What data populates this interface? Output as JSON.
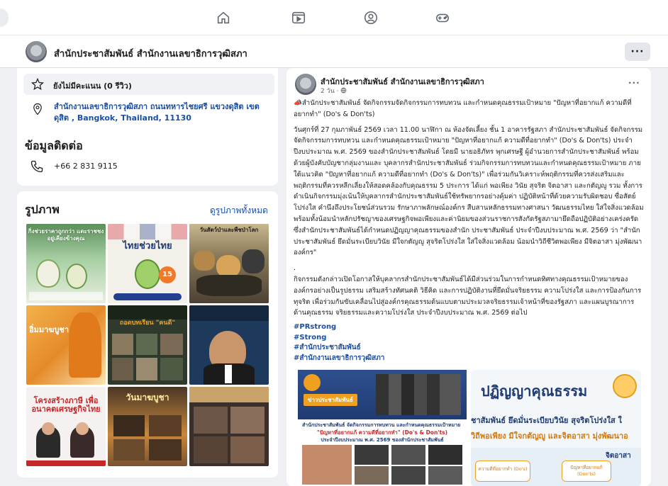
{
  "nav": {
    "icons": [
      "home-icon",
      "video-icon",
      "groups-icon",
      "gaming-icon"
    ]
  },
  "page": {
    "name": "สำนักประชาสัมพันธ์ สำนักงานเลขาธิการวุฒิสภา",
    "more_label": "···"
  },
  "about": {
    "rating": "ยังไม่มีคะแนน (0 รีวิว)",
    "address": "สำนักงานเลขาธิการวุฒิสภา ถนนทหารไชยศรี แขวงดุสิต เขตดุสิต , Bangkok, Thailand, 11130",
    "contact_heading": "ข้อมูลติดต่อ",
    "phone": "+66 2 831 9115"
  },
  "photos": {
    "title": "รูปภาพ",
    "see_all": "ดูรูปภาพทั้งหมด",
    "tiles": [
      {
        "caption": "กิ่งช่วยราคาถูกกว่า แตะราชชงอยู่เคียงข้างคุณ",
        "bg": "#9fc9a3"
      },
      {
        "caption": "ไทยช่วยไทย",
        "bg": "#f3efe9"
      },
      {
        "caption": "วันสัตว์ป่าและพืชป่าโลก",
        "bg": "#6f6350"
      },
      {
        "caption": "อิ่มมาฆบูชา",
        "bg": "#e7a63c"
      },
      {
        "caption": "ถอดบทเรียน \"คนดี\"",
        "bg": "#2f3a2c"
      },
      {
        "caption": "",
        "bg": "#1d3a5c"
      },
      {
        "caption": "โครงสร้างภาษี เพื่ออนาคตเศรษฐกิจไทย",
        "bg": "#f6f1f1"
      },
      {
        "caption": "วันมาฆบูชา",
        "bg": "#c8873a"
      },
      {
        "caption": "",
        "bg": "#3b2f2a"
      }
    ]
  },
  "post": {
    "author": "สำนักประชาสัมพันธ์ สำนักงานเลขาธิการวุฒิสภา",
    "time": "2 วัน · ",
    "more_label": "···",
    "paragraphs": [
      "📣สำนักประชาสัมพันธ์ จัดกิจกรรมจัดกิจกรรมการทบทวน และกำหนดคุณธรรมเป้าหมาย \"ปัญหาที่อยากแก้ ความดีที่อยากทำ\" (Do's & Don'ts)",
      "วันศุกร์ที่ 27 กุมภาพันธ์ 2569 เวลา 11.00 นาฬิกา ณ ห้องจัดเลี้ยง ชั้น 1 อาคารรัฐสภา สำนักประชาสัมพันธ์ จัดกิจกรรมจัดกิจกรรมการทบทวน และกำหนดคุณธรรมเป้าหมาย \"ปัญหาที่อยากแก้ ความดีที่อยากทำ\" (Do's & Don'ts) ประจำปีงบประมาณ พ.ศ. 2569 ของสำนักประชาสัมพันธ์ โดยมี นายอธิภัทร พุกเศรษฐี ผู้อำนวยการสำนักประชาสัมพันธ์ พร้อมด้วยผู้บังคับบัญชากลุ่มงานและ บุคลากรสำนักประชาสัมพันธ์ ร่วมกิจกรรมการทบทวนและกำหนดคุณธรรมเป้าหมาย ภายใต้แนวคิด \"ปัญหาที่อยากแก้ ความดีที่อยากทำ (Do's & Don'ts)\" เพื่อร่วมกันวิเคราะห์พฤติกรรมที่ควรส่งเสริมและพฤติกรรมที่ควรหลีกเลี่ยงให้สอดคล้องกับคุณธรรม 5 ประการ ได้แก่ พอเพียง วินัย สุจริต จิตอาสา และกตัญญู รวม ทั้งการดำเนินกิจกรรมมุ่งเน้นให้บุคลากรสำนักประชาสัมพันธ์ใช้ทรัพยากรอย่างคุ้มค่า ปฏิบัติหน้าที่ด้วยความรับผิดชอบ ซื่อสัตย์ โปร่งใส คำนึงถึงประโยชน์ส่วนรวม รักษาภาพลักษณ์องค์กร สืบสานหลักธรรมทางศาสนา วัฒนธรรมไทย ใส่ใจสิ่งแวดล้อม พร้อมทั้งน้อมนำหลักปรัชญาของเศรษฐกิจพอเพียงและค่านิยมของส่วนราชการสังกัดรัฐสภามายึดถือปฏิบัติอย่างเคร่งครัด ซึ่งสำนักประชาสัมพันธ์ได้กำหนดปฏิญญาคุณธรรมของสำนัก ประชาสัมพันธ์ ประจำปีงบประมาณ พ.ศ. 2569 ว่า \"สำนักประชาสัมพันธ์ ยึดมั่นระเบียบวินัย มีใจกตัญญู สุจริตโปร่งใส ใส่ใจสิ่งแวดล้อม น้อมนำวิถีชีวิตพอเพียง มีจิตอาสา มุ่งพัฒนาองค์กร\"",
      ".",
      "กิจกรรมดังกล่าวเปิดโอกาสให้บุคลากรสำนักประชาสัมพันธ์ได้มีส่วนร่วมในการกำหนดทิศทางคุณธรรมเป้าหมายขององค์กรอย่างเป็นรูปธรรม เสริมสร้างทัศนคติ วิธีคิด และการปฏิบัติงานที่ยึดมั่นจริยธรรม ความโปร่งใส และการป้องกันการทุจริต เพื่อร่วมกันขับเคลื่อนไปสู่องค์กรคุณธรรมต้นแบบตามประมวลจริยธรรมเจ้าหน้าที่ของรัฐสภา และแผนบูรณาการด้านคุณธรรม จริยธรรมและความโปร่งใส ประจำปีงบประมาณ พ.ศ. 2569 ต่อไป"
    ],
    "hashtags": [
      "#PRstrong",
      "#Strong",
      "#สำนักประชาสัมพันธ์",
      "#สำนักงานเลขาธิการวุฒิสภา"
    ],
    "image1": {
      "badge": "ข่าวประชาสัมพันธ์",
      "headline": "สำนักประชาสัมพันธ์ จัดกิจกรรมการทบทวน และกำหนดคุณธรรมเป้าหมาย",
      "highlight": "\"ปัญหาที่อยากแก้ ความดีที่อยากทำ\" (Do's & Don'ts)",
      "subline": "ประจำปีงบประมาณ พ.ศ. 2569 ของสำนักประชาสัมพันธ์"
    },
    "image2": {
      "title": "ปฏิญญาคุณธรรม",
      "line1": "ชาสัมพันธ์ ยึดมั่นระเบียบวินัย สุจริตโปร่งใส ใ",
      "line2": "วิถีพอเพียง มีใจกตัญญู และจิตอาสา มุ่งพัฒนาอ",
      "box1": "ความดีที่อยากทำ (Do's)",
      "box2": "ปัญหาที่อยากแก้ (Don'ts)",
      "label": "จิตอาสา"
    }
  },
  "colors": {
    "link": "#1a4fa3",
    "accent_orange": "#f0a020",
    "navy": "#1f3b73"
  }
}
